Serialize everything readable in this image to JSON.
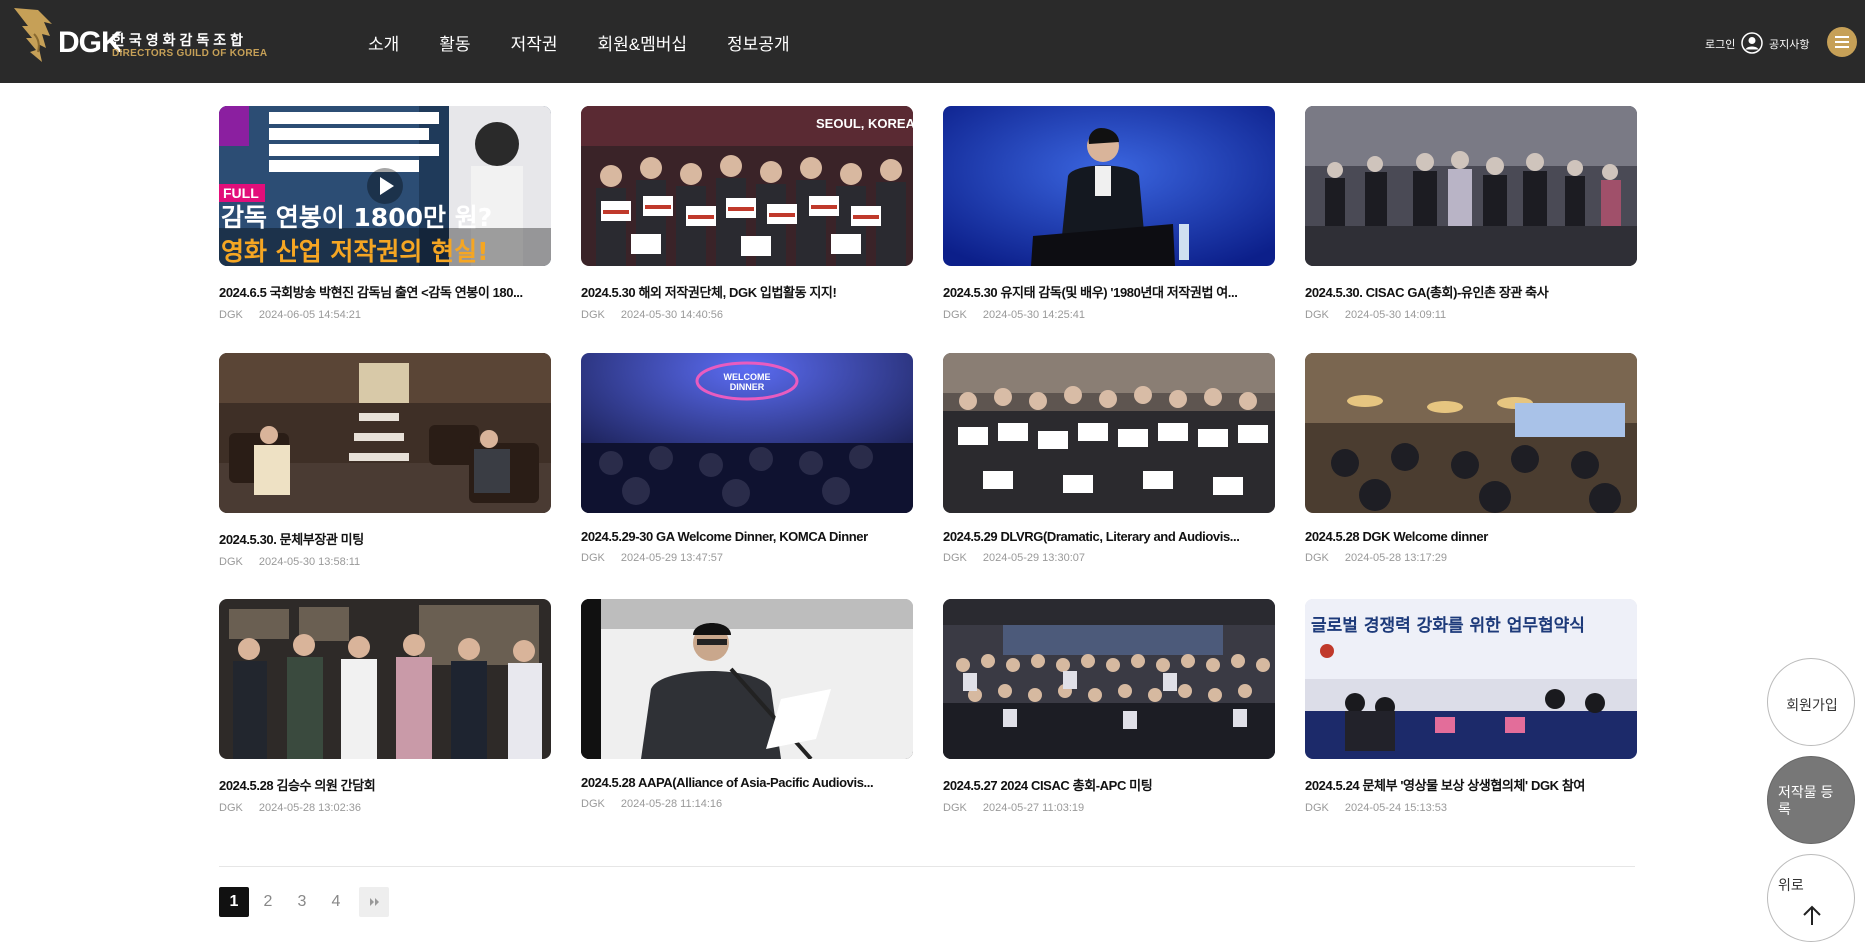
{
  "header": {
    "logo_dgk": "DGK",
    "logo_kr": "한국영화감독조합",
    "logo_en": "DIRECTORS GUILD OF KOREA",
    "nav": [
      "소개",
      "활동",
      "저작권",
      "회원&멤버십",
      "정보공개"
    ],
    "login": "로그인",
    "notice": "공지사항"
  },
  "posts": [
    {
      "title": "2024.6.5 국회방송 박현진 감독님 출연 <감독 연봉이 180...",
      "author": "DGK",
      "date": "2024-06-05 14:54:21",
      "thumb_text": [
        "FULL",
        "감독 연봉이 1800만 원?",
        "영화 산업 저작권의 현실!"
      ],
      "video": true
    },
    {
      "title": "2024.5.30 해외 저작권단체, DGK 입법활동 지지!",
      "author": "DGK",
      "date": "2024-05-30 14:40:56",
      "thumb_text": [
        "SEOUL, KOREA"
      ]
    },
    {
      "title": "2024.5.30 유지태 감독(및 배우) '1980년대 저작권법 여...",
      "author": "DGK",
      "date": "2024-05-30 14:25:41"
    },
    {
      "title": "2024.5.30. CISAC GA(총회)-유인촌 장관 축사",
      "author": "DGK",
      "date": "2024-05-30 14:09:11"
    },
    {
      "title": "2024.5.30. 문체부장관 미팅",
      "author": "DGK",
      "date": "2024-05-30 13:58:11"
    },
    {
      "title": "2024.5.29-30 GA Welcome Dinner, KOMCA Dinner",
      "author": "DGK",
      "date": "2024-05-29 13:47:57",
      "thumb_text": [
        "WELCOME",
        "DINNER"
      ]
    },
    {
      "title": "2024.5.29 DLVRG(Dramatic, Literary and Audiovis...",
      "author": "DGK",
      "date": "2024-05-29 13:30:07"
    },
    {
      "title": "2024.5.28 DGK Welcome dinner",
      "author": "DGK",
      "date": "2024-05-28 13:17:29"
    },
    {
      "title": "2024.5.28 김승수 의원 간담회",
      "author": "DGK",
      "date": "2024-05-28 13:02:36"
    },
    {
      "title": "2024.5.28 AAPA(Alliance of Asia-Pacific Audiovis...",
      "author": "DGK",
      "date": "2024-05-28 11:14:16"
    },
    {
      "title": "2024.5.27 2024 CISAC 총회-APC 미팅",
      "author": "DGK",
      "date": "2024-05-27 11:03:19"
    },
    {
      "title": "2024.5.24 문체부 '영상물 보상 상생협의체' DGK 참여",
      "author": "DGK",
      "date": "2024-05-24 15:13:53",
      "thumb_text": [
        "글로벌 경쟁력 강화를 위한 업무협약식"
      ]
    }
  ],
  "pagination": {
    "pages": [
      "1",
      "2",
      "3",
      "4"
    ],
    "current": "1"
  },
  "floating": {
    "join": "회원가입",
    "register": "저작물 등록",
    "top": "위로"
  },
  "colors": {
    "header_bg": "#2a2a2a",
    "accent": "#c6a057",
    "active_page": "#111111",
    "register_bg": "#777777"
  }
}
